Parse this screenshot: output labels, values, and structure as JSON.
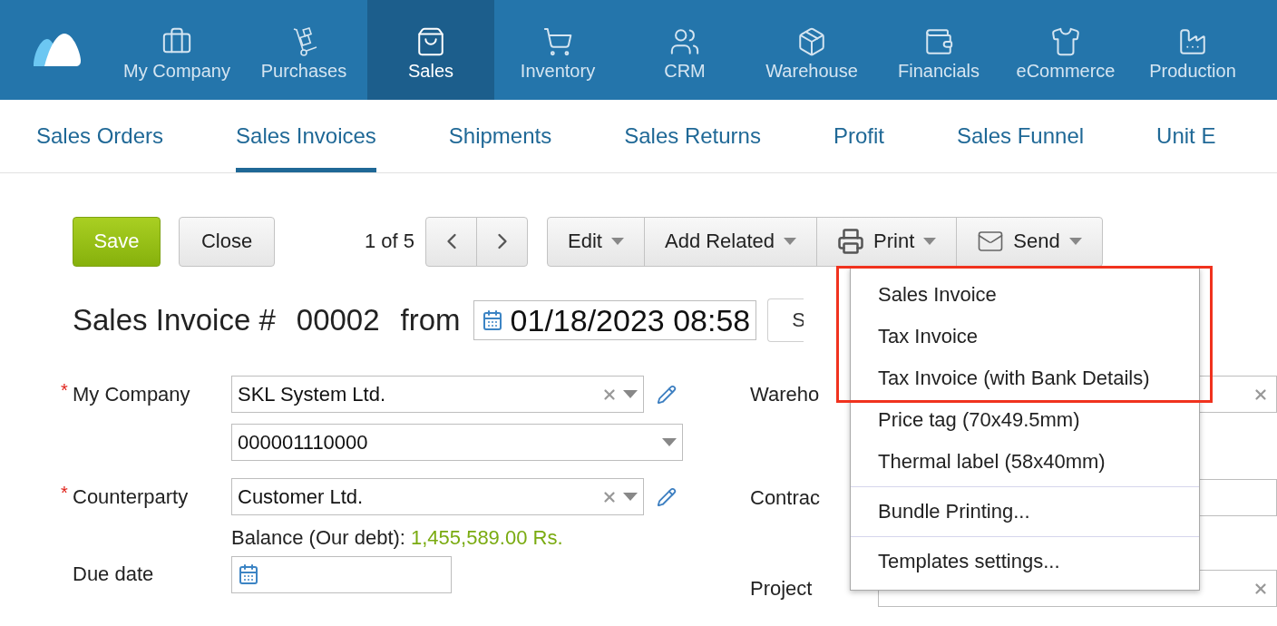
{
  "app_nav": {
    "items": [
      {
        "label": "My Company",
        "selected": false
      },
      {
        "label": "Purchases",
        "selected": false
      },
      {
        "label": "Sales",
        "selected": true
      },
      {
        "label": "Inventory",
        "selected": false
      },
      {
        "label": "CRM",
        "selected": false
      },
      {
        "label": "Warehouse",
        "selected": false
      },
      {
        "label": "Financials",
        "selected": false
      },
      {
        "label": "eCommerce",
        "selected": false
      },
      {
        "label": "Production",
        "selected": false
      }
    ]
  },
  "sub_nav": {
    "items": [
      {
        "label": "Sales Orders",
        "selected": false
      },
      {
        "label": "Sales Invoices",
        "selected": true
      },
      {
        "label": "Shipments",
        "selected": false
      },
      {
        "label": "Sales Returns",
        "selected": false
      },
      {
        "label": "Profit",
        "selected": false
      },
      {
        "label": "Sales Funnel",
        "selected": false
      },
      {
        "label": "Unit E",
        "selected": false
      }
    ]
  },
  "toolbar": {
    "save": "Save",
    "close": "Close",
    "pager": "1 of 5",
    "actions": [
      {
        "kind": "plain",
        "label": "Edit"
      },
      {
        "kind": "plain",
        "label": "Add Related"
      },
      {
        "kind": "print",
        "label": "Print"
      },
      {
        "kind": "send",
        "label": "Send"
      }
    ]
  },
  "document": {
    "title": "Sales Invoice #",
    "number": "00002",
    "from": "from",
    "date": "01/18/2023 08:58",
    "next_field": "S"
  },
  "form": {
    "left": [
      {
        "kind": "select",
        "label": "My Company",
        "required_mark": "*",
        "value": "SKL System Ltd."
      },
      {
        "kind": "subselect",
        "value": "000001110000"
      },
      {
        "kind": "select",
        "label": "Counterparty",
        "required_mark": "*",
        "value": "Customer Ltd."
      },
      {
        "kind": "balance",
        "label": "Balance (Our debt):",
        "value": "1,455,589.00 Rs."
      },
      {
        "kind": "date",
        "label": "Due date"
      }
    ],
    "right": [
      {
        "label": "Wareho",
        "clearable": true
      },
      {
        "label": "Contrac",
        "clearable": false
      },
      {
        "label": "Project",
        "clearable": true
      }
    ]
  },
  "print_menu": {
    "sections": [
      [
        {
          "label": "Sales Invoice",
          "highlighted": true
        },
        {
          "label": "Tax Invoice",
          "highlighted": true
        },
        {
          "label": "Tax Invoice (with Bank Details)",
          "highlighted": true
        },
        {
          "label": "Price tag (70x49.5mm)",
          "highlighted": false
        },
        {
          "label": "Thermal label (58x40mm)",
          "highlighted": false
        }
      ],
      [
        {
          "label": "Bundle Printing...",
          "highlighted": false
        }
      ],
      [
        {
          "label": "Templates settings...",
          "highlighted": false
        }
      ]
    ]
  }
}
